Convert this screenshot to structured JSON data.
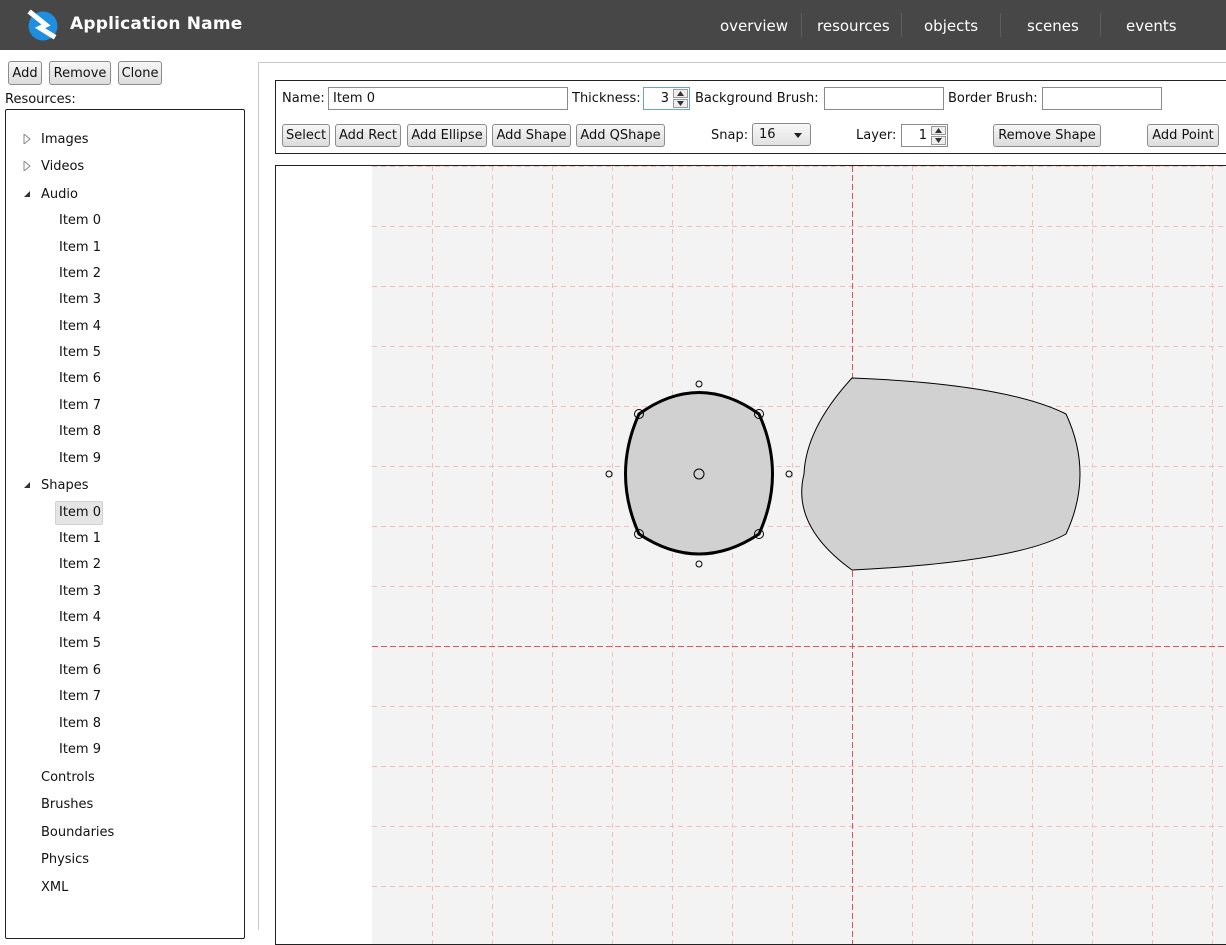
{
  "header": {
    "title": "Application Name",
    "nav": [
      "overview",
      "resources",
      "objects",
      "scenes",
      "events"
    ]
  },
  "sidebar": {
    "buttons": {
      "add": "Add",
      "remove": "Remove",
      "clone": "Clone"
    },
    "resources_label": "Resources:",
    "tree": {
      "images": "Images",
      "videos": "Videos",
      "audio": "Audio",
      "audio_items": [
        "Item 0",
        "Item 1",
        "Item 2",
        "Item 3",
        "Item 4",
        "Item 5",
        "Item 6",
        "Item 7",
        "Item 8",
        "Item 9"
      ],
      "shapes": "Shapes",
      "shape_items": [
        "Item 0",
        "Item 1",
        "Item 2",
        "Item 3",
        "Item 4",
        "Item 5",
        "Item 6",
        "Item 7",
        "Item 8",
        "Item 9"
      ],
      "selected_shape_index": 0,
      "controls": "Controls",
      "brushes": "Brushes",
      "boundaries": "Boundaries",
      "physics": "Physics",
      "xml": "XML"
    }
  },
  "editor": {
    "name_label": "Name:",
    "name_value": "Item 0",
    "thickness_label": "Thickness:",
    "thickness_value": "3",
    "background_brush_label": "Background Brush:",
    "background_brush_value": "",
    "border_brush_label": "Border Brush:",
    "border_brush_value": "",
    "buttons": {
      "select": "Select",
      "add_rect": "Add Rect",
      "add_ellipse": "Add Ellipse",
      "add_shape": "Add Shape",
      "add_qshape": "Add QShape",
      "remove_shape": "Remove Shape",
      "add_point": "Add Point"
    },
    "snap_label": "Snap:",
    "snap_value": "16",
    "layer_label": "Layer:",
    "layer_value": "1"
  },
  "colors": {
    "header_bg": "#474747",
    "logo_blue": "#1e8fe0",
    "canvas_bg": "#f3f3f3",
    "grid_minor": "#f4bcbc",
    "grid_axis": "#dd5555",
    "shape_fill": "#d1d1d1"
  }
}
